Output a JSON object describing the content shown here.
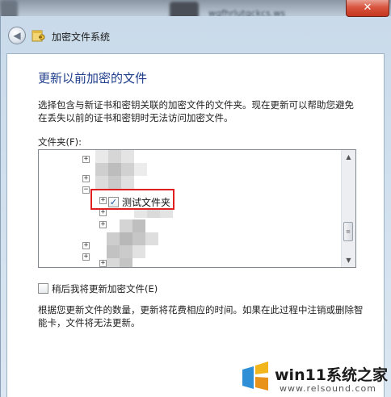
{
  "window": {
    "title": "加密文件系统",
    "close_label": "✕",
    "back_label": "◀"
  },
  "background": {
    "blurred_text": "wgfhrlutgckcs.ws"
  },
  "page": {
    "heading": "更新以前加密的文件",
    "description": "选择包含与新证书和密钥关联的加密文件的文件夹。现在更新可以帮助您避免在丢失以前的证书和密钥时无法访问加密文件。",
    "folder_label": "文件夹(F):",
    "update_later_label": "稍后我将更新加密文件(E)",
    "note": "根据您更新文件的数量，更新将花费相应的时间。如果在此过程中注销或删除智能卡，文件将无法更新。"
  },
  "tree": {
    "expanders": [
      "+",
      "+",
      "−",
      "+",
      "+",
      "+",
      "+",
      "+",
      "+"
    ],
    "selected_node": {
      "label": "测试文件夹",
      "checked": true,
      "check_glyph": "✓"
    },
    "scroll_up": "▲",
    "scroll_down": "▼",
    "thumb_grip": "≡"
  },
  "watermark": {
    "brand": "win11系统之家",
    "url": "www.relsound.com"
  },
  "colors": {
    "heading": "#1e3e8c",
    "highlight_border": "#e02020",
    "close_button": "#c4361f"
  },
  "icons": {
    "back": "back-arrow-icon",
    "wizard": "encryption-key-icon",
    "watermark_logo": "windows-logo-icon"
  }
}
